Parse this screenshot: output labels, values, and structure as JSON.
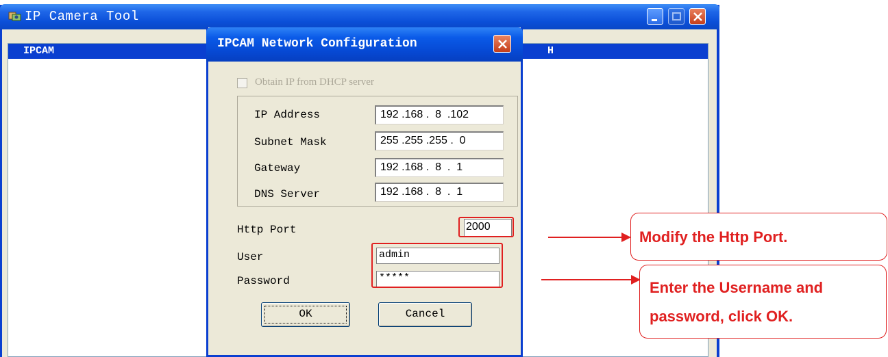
{
  "main_window": {
    "title": "IP Camera Tool",
    "list_columns": [
      "IPCAM",
      "H"
    ]
  },
  "dialog": {
    "title": "IPCAM Network Configuration",
    "dhcp_label": "Obtain IP from DHCP server",
    "dhcp_checked": false,
    "fields": {
      "ip_label": "IP Address",
      "ip_value": "192 .168 .  8  .102",
      "subnet_label": "Subnet Mask",
      "subnet_value": "255 .255 .255 .  0",
      "gateway_label": "Gateway",
      "gateway_value": "192 .168 .  8  .  1",
      "dns_label": "DNS Server",
      "dns_value": "192 .168 .  8  .  1"
    },
    "http_port_label": "Http Port",
    "http_port_value": "2000",
    "user_label": "User",
    "user_value": "admin",
    "password_label": "Password",
    "password_value": "*****",
    "ok_label": "OK",
    "cancel_label": "Cancel"
  },
  "annotations": {
    "callout1": "Modify the Http Port.",
    "callout2_line1": "Enter the Username and",
    "callout2_line2": "password, click OK.",
    "color": "#e02020"
  }
}
